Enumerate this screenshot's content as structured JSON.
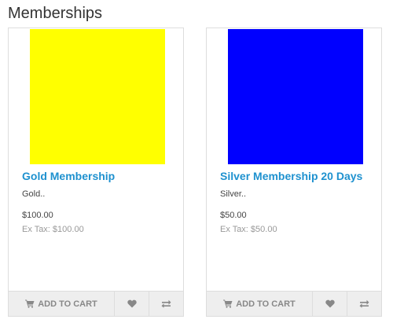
{
  "page": {
    "title": "Memberships"
  },
  "products": [
    {
      "name": "Gold Membership",
      "description": "Gold..",
      "price": "$100.00",
      "ex_tax": "Ex Tax: $100.00",
      "image_color": "#ffff00",
      "buttons": {
        "add_to_cart": "Add to Cart",
        "wishlist_icon": "heart-icon",
        "compare_icon": "exchange-icon"
      }
    },
    {
      "name": "Silver Membership 20 Days",
      "description": "Silver..",
      "price": "$50.00",
      "ex_tax": "Ex Tax: $50.00",
      "image_color": "#0000ff",
      "buttons": {
        "add_to_cart": "Add to Cart",
        "wishlist_icon": "heart-icon",
        "compare_icon": "exchange-icon"
      }
    }
  ],
  "colors": {
    "link": "#1e91cf",
    "button_bg": "#eeeeee",
    "button_text": "#888888",
    "border": "#dddddd"
  }
}
